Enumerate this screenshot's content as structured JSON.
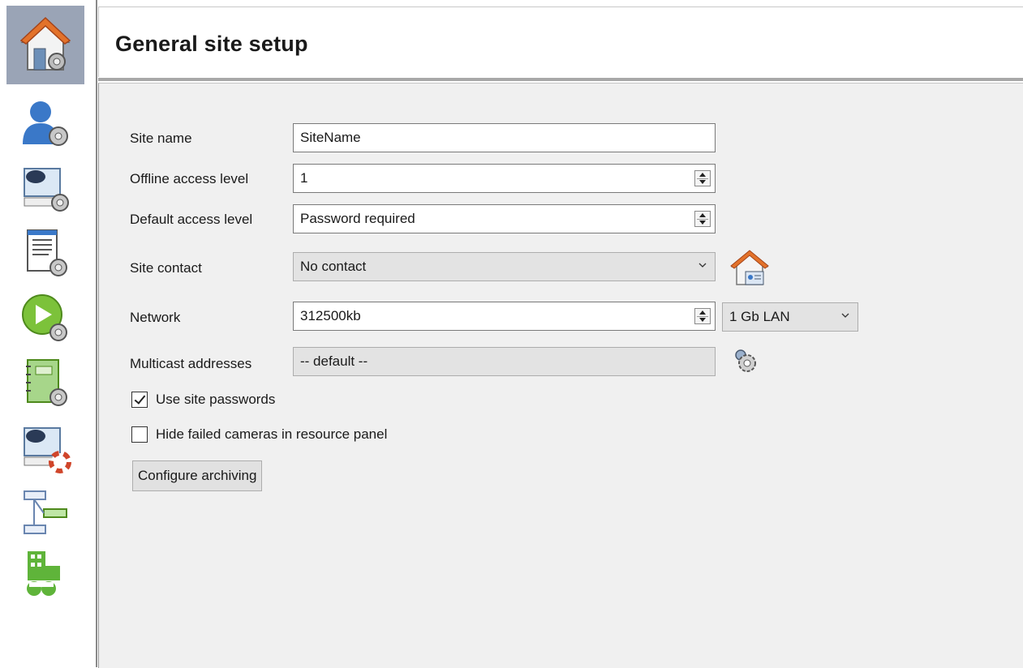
{
  "header": {
    "title": "General site setup"
  },
  "sidebar": {
    "items": [
      {
        "name": "general-site-setup",
        "icon": "house-gear-icon",
        "selected": true
      },
      {
        "name": "users",
        "icon": "user-gear-icon"
      },
      {
        "name": "cameras",
        "icon": "camera-gear-icon"
      },
      {
        "name": "logs",
        "icon": "document-gear-icon"
      },
      {
        "name": "playback",
        "icon": "play-gear-icon"
      },
      {
        "name": "notebook",
        "icon": "notebook-gear-icon"
      },
      {
        "name": "camera-support",
        "icon": "camera-lifebuoy-icon"
      },
      {
        "name": "hierarchy",
        "icon": "tree-icon"
      },
      {
        "name": "buildings",
        "icon": "building-icon"
      }
    ]
  },
  "form": {
    "site_name": {
      "label": "Site name",
      "value": "SiteName"
    },
    "offline_access_level": {
      "label": "Offline access level",
      "value": "1"
    },
    "default_access_level": {
      "label": "Default access level",
      "value": "Password required"
    },
    "site_contact": {
      "label": "Site contact",
      "value": "No contact"
    },
    "network": {
      "label": "Network",
      "value": "312500kb",
      "speed": "1 Gb LAN"
    },
    "multicast_addresses": {
      "label": "Multicast addresses",
      "value": "-- default --"
    },
    "use_site_passwords": {
      "label": "Use site passwords",
      "checked": true
    },
    "hide_failed_cameras": {
      "label": "Hide failed cameras in resource panel",
      "checked": false
    },
    "configure_archiving": {
      "label": "Configure archiving"
    }
  },
  "colors": {
    "selected_nav": "#9aa4b6",
    "panel_bg": "#f0f0f0",
    "green_accent": "#6cbf3a",
    "blue_accent": "#3a78c8"
  }
}
